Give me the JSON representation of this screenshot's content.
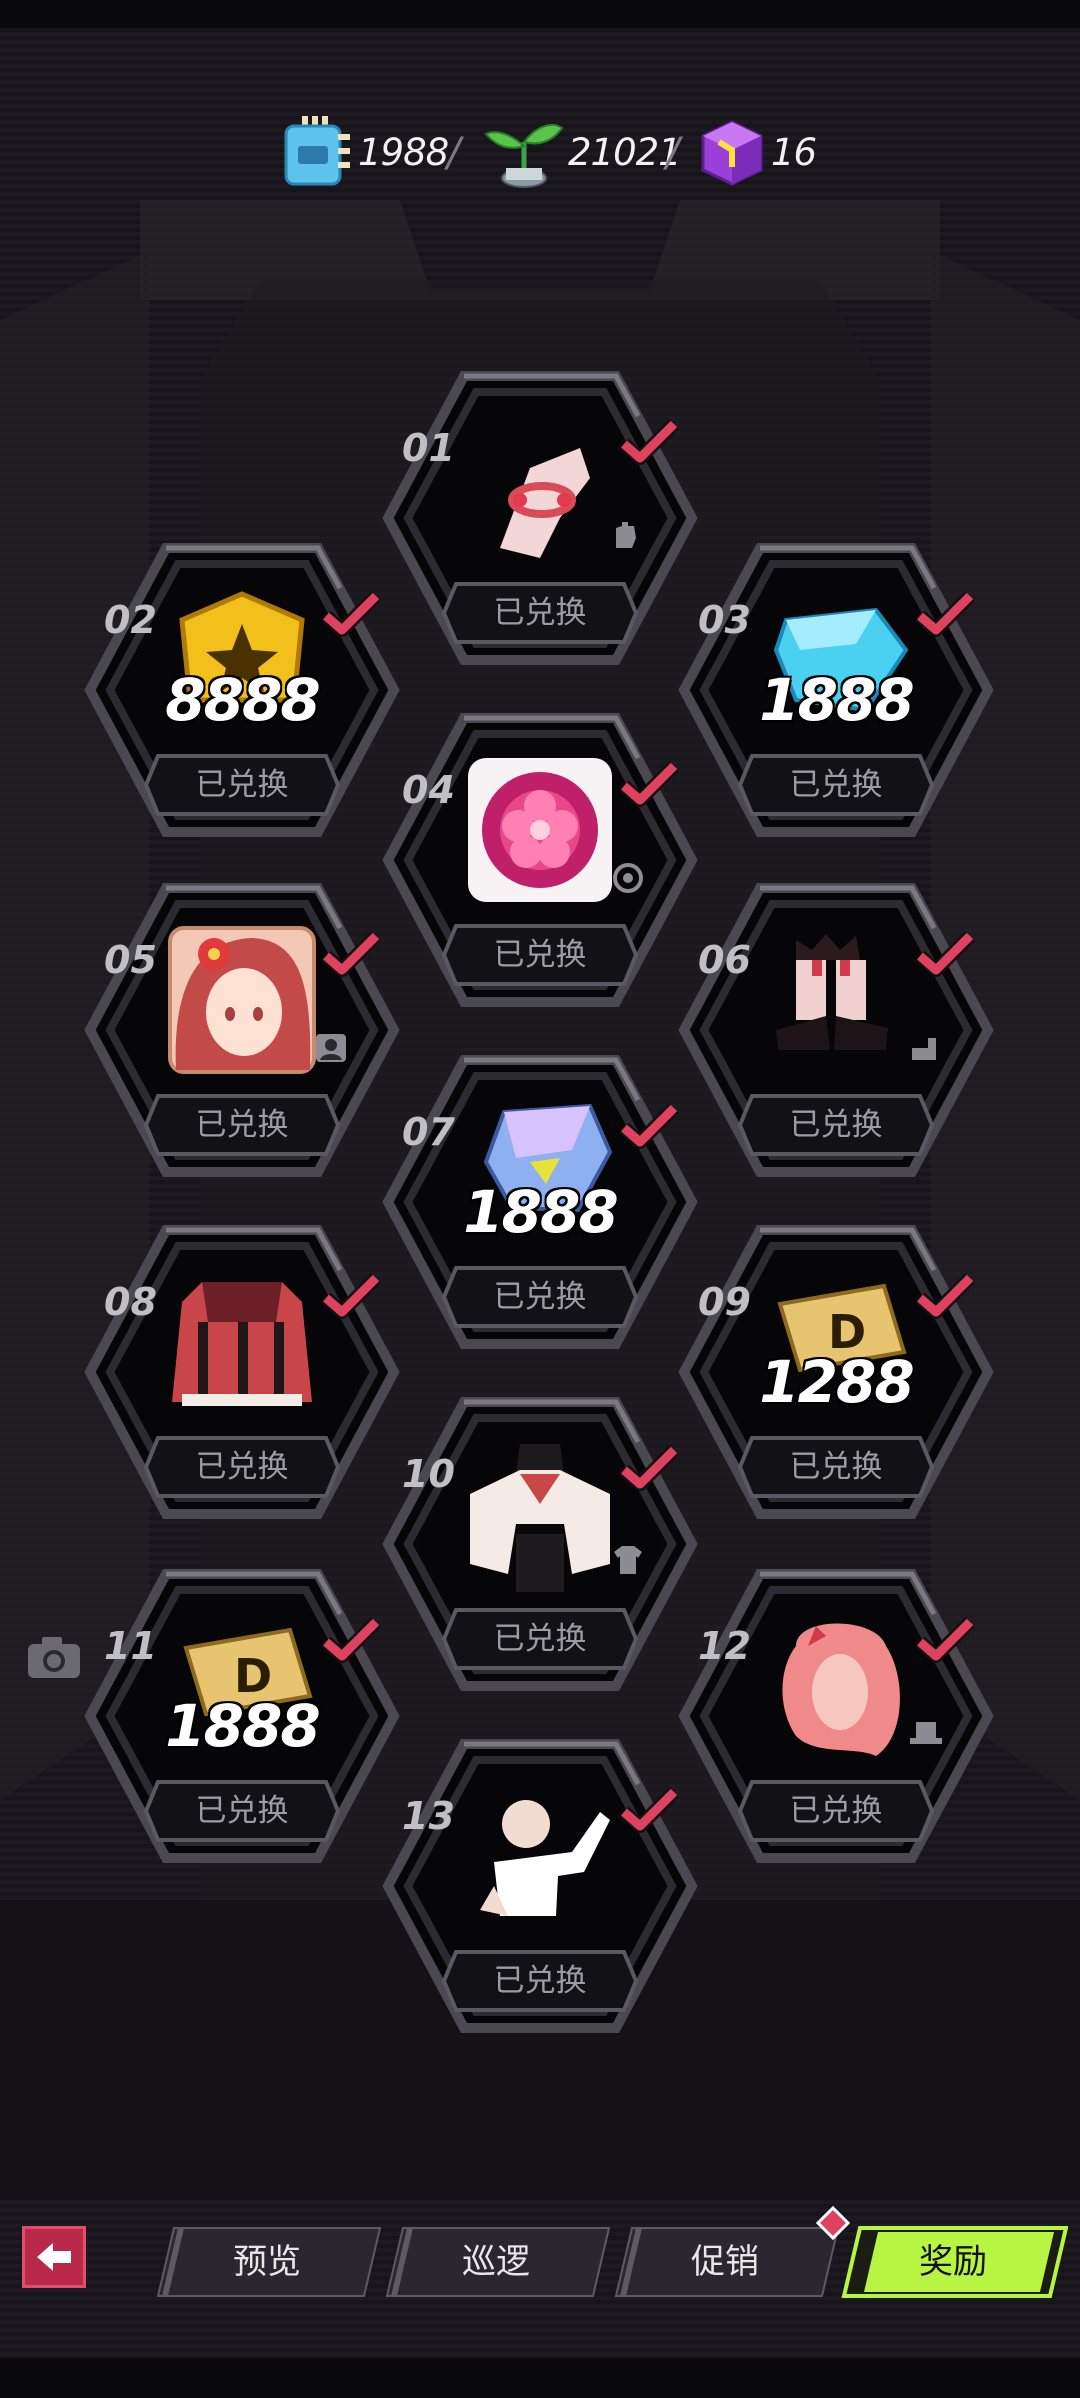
{
  "currencies": [
    {
      "icon": "ticket-icon",
      "value": "1988"
    },
    {
      "icon": "sprout-icon",
      "value": "21021"
    },
    {
      "icon": "cube-icon",
      "value": "16"
    }
  ],
  "rewards": [
    {
      "num": "01",
      "item": "bracelet-icon",
      "status": "已兑换",
      "claimed": true,
      "tag": "glove-icon"
    },
    {
      "num": "02",
      "item": "gold-badge-icon",
      "count": "8888",
      "status": "已兑换",
      "claimed": true
    },
    {
      "num": "03",
      "item": "blue-crystal-icon",
      "count": "1888",
      "status": "已兑换",
      "claimed": true
    },
    {
      "num": "04",
      "item": "flower-orb-icon",
      "status": "已兑换",
      "claimed": true,
      "tag": "ring-tag-icon"
    },
    {
      "num": "05",
      "item": "character-avatar-icon",
      "status": "已兑换",
      "claimed": true,
      "tag": "avatar-tag-icon"
    },
    {
      "num": "06",
      "item": "shoes-icon",
      "status": "已兑换",
      "claimed": true,
      "tag": "shoe-tag-icon"
    },
    {
      "num": "07",
      "item": "rainbow-crystal-icon",
      "count": "1888",
      "status": "已兑换",
      "claimed": true
    },
    {
      "num": "08",
      "item": "skirt-icon",
      "status": "已兑换",
      "claimed": true
    },
    {
      "num": "09",
      "item": "gold-ticket-icon",
      "count": "1288",
      "status": "已兑换",
      "claimed": true
    },
    {
      "num": "10",
      "item": "outfit-icon",
      "status": "已兑换",
      "claimed": true,
      "tag": "shirt-tag-icon"
    },
    {
      "num": "11",
      "item": "gold-ticket-icon",
      "count": "1888",
      "status": "已兑换",
      "claimed": true
    },
    {
      "num": "12",
      "item": "hair-icon",
      "status": "已兑换",
      "claimed": true,
      "tag": "hat-tag-icon"
    },
    {
      "num": "13",
      "item": "pose-icon",
      "status": "已兑换",
      "claimed": true
    }
  ],
  "nav": {
    "tabs": [
      {
        "label": "预览",
        "active": false
      },
      {
        "label": "巡逻",
        "active": false
      },
      {
        "label": "促销",
        "active": false,
        "badge": true
      },
      {
        "label": "奖励",
        "active": true
      }
    ]
  },
  "colors": {
    "accent": "#e0415f",
    "active_tab": "#b8f542",
    "background": "#141217"
  }
}
